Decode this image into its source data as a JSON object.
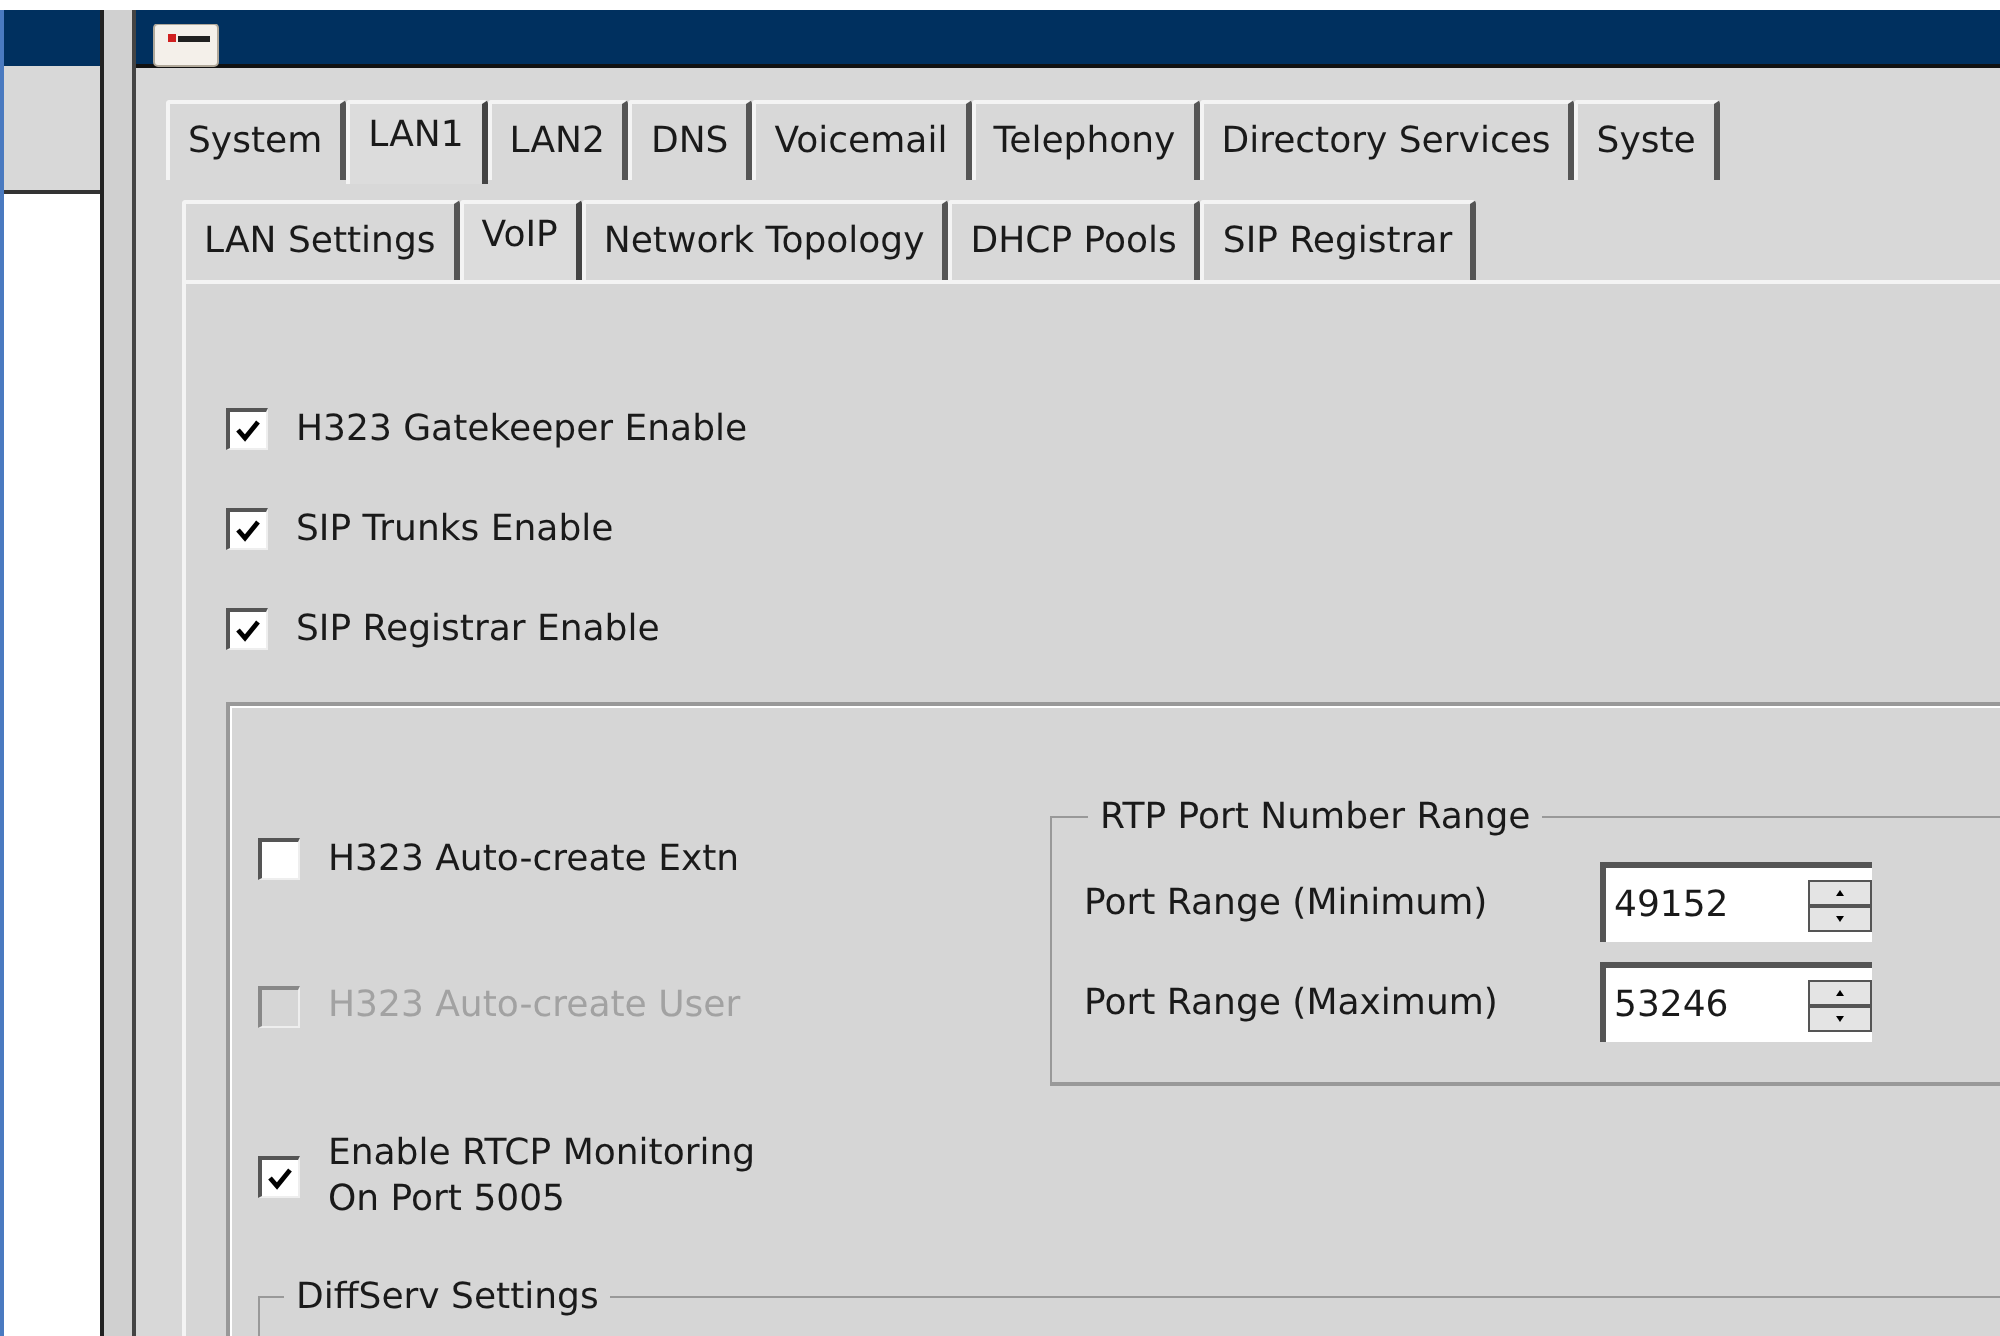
{
  "tabs": [
    {
      "label": "System",
      "selected": false
    },
    {
      "label": "LAN1",
      "selected": true
    },
    {
      "label": "LAN2",
      "selected": false
    },
    {
      "label": "DNS",
      "selected": false
    },
    {
      "label": "Voicemail",
      "selected": false
    },
    {
      "label": "Telephony",
      "selected": false
    },
    {
      "label": "Directory Services",
      "selected": false
    },
    {
      "label": "Syste",
      "selected": false
    }
  ],
  "subtabs": [
    {
      "label": "LAN Settings",
      "selected": false
    },
    {
      "label": "VoIP",
      "selected": true
    },
    {
      "label": "Network Topology",
      "selected": false
    },
    {
      "label": "DHCP Pools",
      "selected": false
    },
    {
      "label": "SIP Registrar",
      "selected": false
    }
  ],
  "options": [
    {
      "label": "H323 Gatekeeper Enable",
      "checked": true,
      "disabled": false
    },
    {
      "label": "SIP Trunks Enable",
      "checked": true,
      "disabled": false
    },
    {
      "label": "SIP Registrar Enable",
      "checked": true,
      "disabled": false
    }
  ],
  "group": {
    "options": [
      {
        "label": "H323 Auto-create Extn",
        "checked": false,
        "disabled": false
      },
      {
        "label": "H323 Auto-create User",
        "checked": false,
        "disabled": true
      },
      {
        "label": "Enable RTCP Monitoring On Port 5005",
        "checked": true,
        "disabled": false
      }
    ],
    "rtp": {
      "title": "RTP Port Number Range",
      "fields": [
        {
          "label": "Port Range (Minimum)",
          "value": "49152"
        },
        {
          "label": "Port Range (Maximum)",
          "value": "53246"
        }
      ]
    },
    "diffserv": {
      "title": "DiffServ Settings"
    }
  }
}
